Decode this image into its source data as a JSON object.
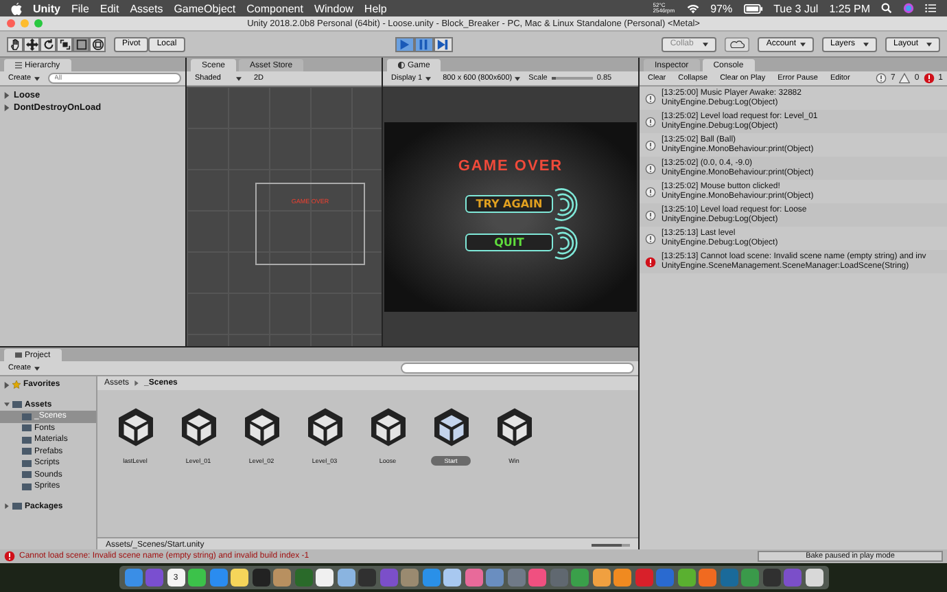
{
  "menu_bar": {
    "app_name": "Unity",
    "items": [
      "File",
      "Edit",
      "Assets",
      "GameObject",
      "Component",
      "Window",
      "Help"
    ],
    "temperature": "52°C",
    "fan": "2546rpm",
    "battery": "97%",
    "date": "Tue 3 Jul",
    "time": "1:25 PM"
  },
  "window": {
    "title": "Unity 2018.2.0b8 Personal (64bit) - Loose.unity - Block_Breaker - PC, Mac & Linux Standalone (Personal) <Metal>"
  },
  "toolbar": {
    "tools": [
      {
        "kind": "hand",
        "selected": false
      },
      {
        "kind": "move",
        "selected": false
      },
      {
        "kind": "rotate",
        "selected": false
      },
      {
        "kind": "scale",
        "selected": false
      },
      {
        "kind": "rect",
        "selected": true
      },
      {
        "kind": "transform",
        "selected": false
      }
    ],
    "pivot": "Pivot",
    "local": "Local",
    "playback": [
      {
        "kind": "play",
        "selected": true
      },
      {
        "kind": "pause",
        "selected": true
      },
      {
        "kind": "step",
        "selected": false
      }
    ],
    "collab": "Collab",
    "account": "Account",
    "layers": "Layers",
    "layout": "Layout"
  },
  "hierarchy": {
    "tab": "Hierarchy",
    "create": "Create",
    "search_placeholder": "All",
    "items": [
      {
        "label": "Loose"
      },
      {
        "label": "DontDestroyOnLoad"
      }
    ]
  },
  "scene": {
    "tabs": [
      {
        "label": "Scene",
        "selected": true
      },
      {
        "label": "Asset Store",
        "selected": false
      }
    ],
    "shading": "Shaded",
    "mode_2d": "2D",
    "canvas_title": "GAME OVER"
  },
  "game": {
    "tab": "Game",
    "display": "Display 1",
    "resolution": "800 x 600 (800x600)",
    "scale_label": "Scale",
    "scale": "0.85",
    "scale_slider": {
      "level": 0.1
    },
    "title": "GAME OVER",
    "buttons": [
      {
        "label": "TRY AGAIN",
        "color": "#e0a020"
      },
      {
        "label": "QUIT",
        "color": "#5fdc3c"
      }
    ]
  },
  "console": {
    "tabs": [
      {
        "label": "Inspector",
        "selected": false
      },
      {
        "label": "Console",
        "selected": true
      }
    ],
    "buttons": [
      "Clear",
      "Collapse",
      "Clear on Play",
      "Error Pause",
      "Editor"
    ],
    "info_count": "7",
    "warning_count": "0",
    "error_count": "1",
    "entries": [
      {
        "kind": "info",
        "message": "[13:25:00] Music Player Awake: 32882",
        "trace": "UnityEngine.Debug:Log(Object)"
      },
      {
        "kind": "info",
        "message": "[13:25:02] Level load request for: Level_01",
        "trace": "UnityEngine.Debug:Log(Object)"
      },
      {
        "kind": "info",
        "message": "[13:25:02] Ball (Ball)",
        "trace": "UnityEngine.MonoBehaviour:print(Object)"
      },
      {
        "kind": "info",
        "message": "[13:25:02] (0.0, 0.4, -9.0)",
        "trace": "UnityEngine.MonoBehaviour:print(Object)"
      },
      {
        "kind": "info",
        "message": "[13:25:02] Mouse button clicked!",
        "trace": "UnityEngine.MonoBehaviour:print(Object)"
      },
      {
        "kind": "info",
        "message": "[13:25:10] Level load request for: Loose",
        "trace": "UnityEngine.Debug:Log(Object)"
      },
      {
        "kind": "info",
        "message": "[13:25:13] Last level",
        "trace": "UnityEngine.Debug:Log(Object)"
      },
      {
        "kind": "error",
        "message": "[13:25:13] Cannot load scene: Invalid scene name (empty string) and inv",
        "trace": "UnityEngine.SceneManagement.SceneManager:LoadScene(String)"
      }
    ]
  },
  "project": {
    "tab": "Project",
    "create": "Create",
    "favorites": "Favorites",
    "tree": [
      {
        "label": "Assets",
        "expanded": true,
        "children": [
          {
            "label": "_Scenes",
            "selected": true
          },
          {
            "label": "Fonts",
            "selected": false
          },
          {
            "label": "Materials",
            "selected": false
          },
          {
            "label": "Prefabs",
            "selected": false
          },
          {
            "label": "Scripts",
            "selected": false
          },
          {
            "label": "Sounds",
            "selected": false
          },
          {
            "label": "Sprites",
            "selected": false
          }
        ]
      },
      {
        "label": "Packages",
        "expanded": false
      }
    ],
    "breadcrumb": [
      "Assets",
      "_Scenes"
    ],
    "assets": [
      {
        "name": "lastLevel",
        "selected": false
      },
      {
        "name": "Level_01",
        "selected": false
      },
      {
        "name": "Level_02",
        "selected": false
      },
      {
        "name": "Level_03",
        "selected": false
      },
      {
        "name": "Loose",
        "selected": false
      },
      {
        "name": "Start",
        "selected": true
      },
      {
        "name": "Win",
        "selected": false
      }
    ],
    "path": "Assets/_Scenes/Start.unity",
    "icon_size_slider": {
      "level": 0.8
    }
  },
  "status_bar": {
    "message": "Cannot load scene: Invalid scene name (empty string) and invalid build index -1",
    "bake": "Bake paused in play mode"
  },
  "dock": [
    {
      "color": "#3a8ee6"
    },
    {
      "color": "#7a4fd0"
    },
    {
      "color": "#f4f4f4",
      "label": "3"
    },
    {
      "color": "#3cc24a"
    },
    {
      "color": "#2a8cf0"
    },
    {
      "color": "#f5d55a"
    },
    {
      "color": "#222222"
    },
    {
      "color": "#b89060"
    },
    {
      "color": "#2a6a2a"
    },
    {
      "color": "#f0f0f0"
    },
    {
      "color": "#8ab4e0"
    },
    {
      "color": "#303030"
    },
    {
      "color": "#7b4fc9"
    },
    {
      "color": "#9a8a70"
    },
    {
      "color": "#2a90e8"
    },
    {
      "color": "#a8c8f0"
    },
    {
      "color": "#e86a9a"
    },
    {
      "color": "#6a8ec0"
    },
    {
      "color": "#707a88"
    },
    {
      "color": "#f05080"
    },
    {
      "color": "#606870"
    },
    {
      "color": "#3aa04a"
    },
    {
      "color": "#f0a040"
    },
    {
      "color": "#f08a20"
    },
    {
      "color": "#d8202a"
    },
    {
      "color": "#2a6ad0"
    },
    {
      "color": "#5ab030"
    },
    {
      "color": "#f06a20"
    },
    {
      "color": "#1a6a9a"
    },
    {
      "color": "#3a9a4a"
    },
    {
      "color": "#303030"
    },
    {
      "color": "#7b4fc9"
    },
    {
      "color": "#d8d8d8"
    }
  ]
}
